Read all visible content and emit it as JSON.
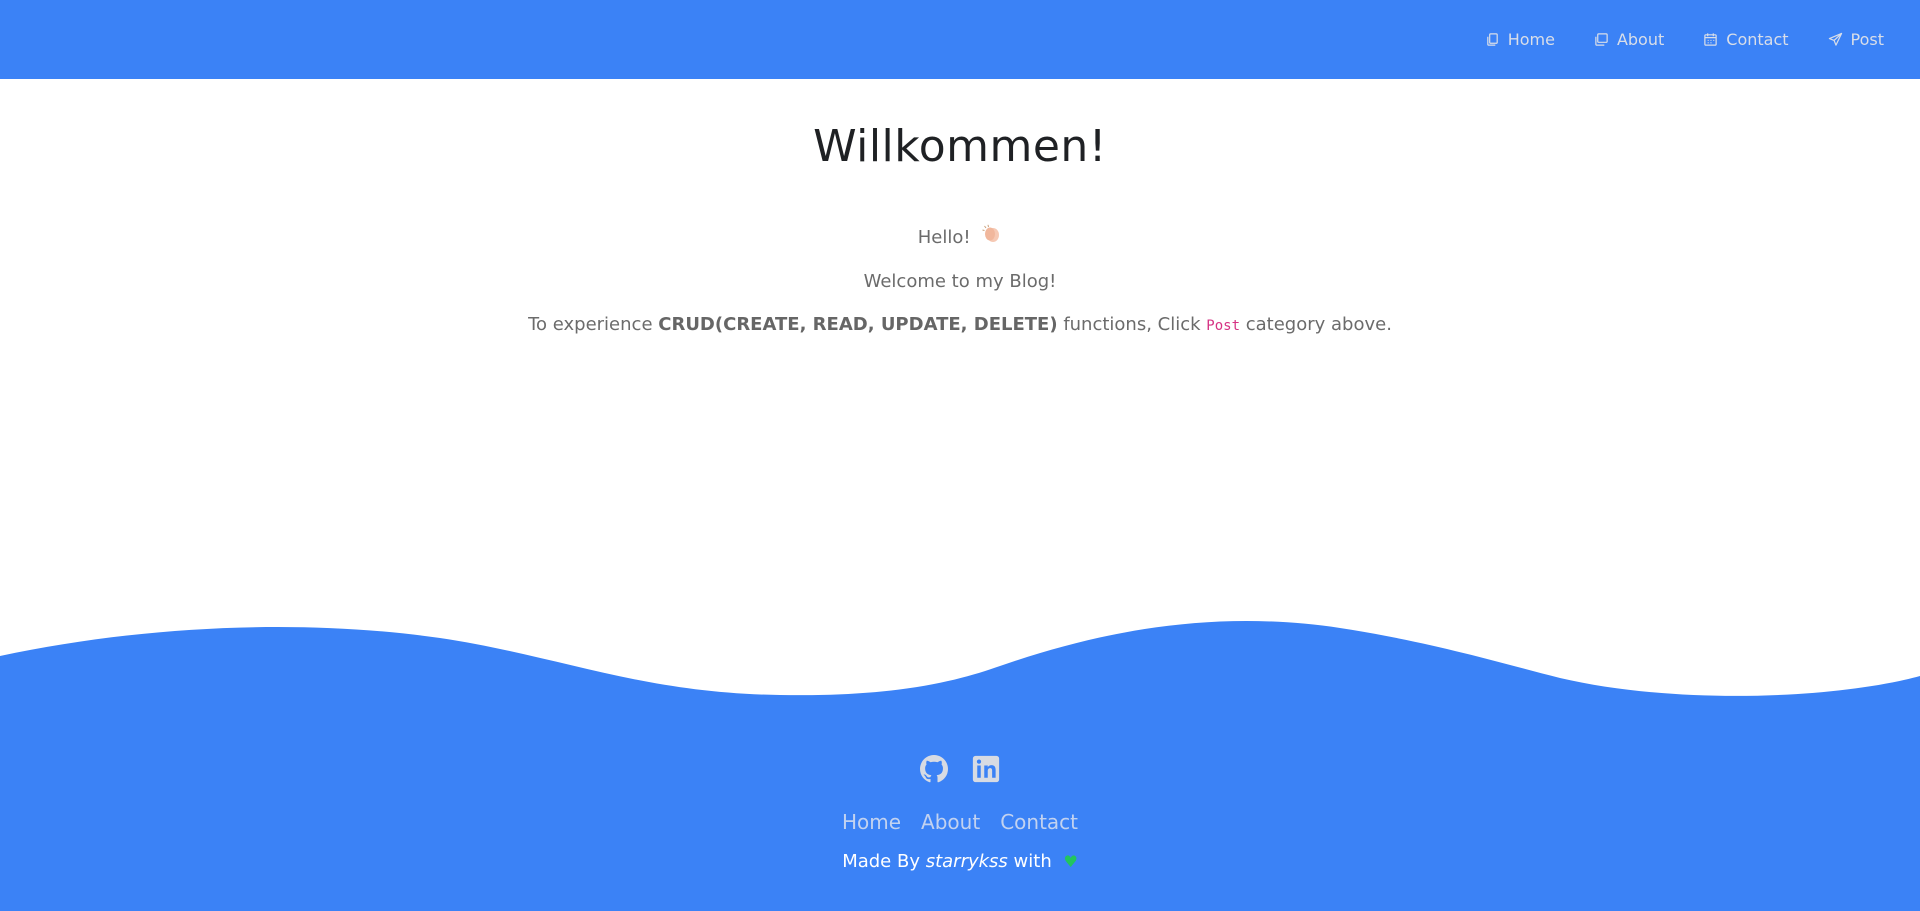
{
  "nav": {
    "items": [
      {
        "label": "Home",
        "icon": "copy-icon"
      },
      {
        "label": "About",
        "icon": "window-icon"
      },
      {
        "label": "Contact",
        "icon": "calendar-icon"
      },
      {
        "label": "Post",
        "icon": "send-icon"
      }
    ]
  },
  "main": {
    "title": "Willkommen!",
    "hello": "Hello!",
    "welcome": "Welcome to my Blog!",
    "crud_prefix": "To experience ",
    "crud_bold": "CRUD(CREATE, READ, UPDATE, DELETE)",
    "crud_middle": " functions, Click ",
    "crud_code": "Post",
    "crud_suffix": " category above."
  },
  "footer": {
    "social": [
      {
        "icon": "github-icon"
      },
      {
        "icon": "linkedin-icon"
      }
    ],
    "links": [
      "Home",
      "About",
      "Contact"
    ],
    "credit_prefix": "Made By ",
    "credit_author": "starrykss",
    "credit_suffix": " with "
  },
  "colors": {
    "brand": "#3b82f6",
    "heart": "#22c55e",
    "code": "#d63384"
  }
}
